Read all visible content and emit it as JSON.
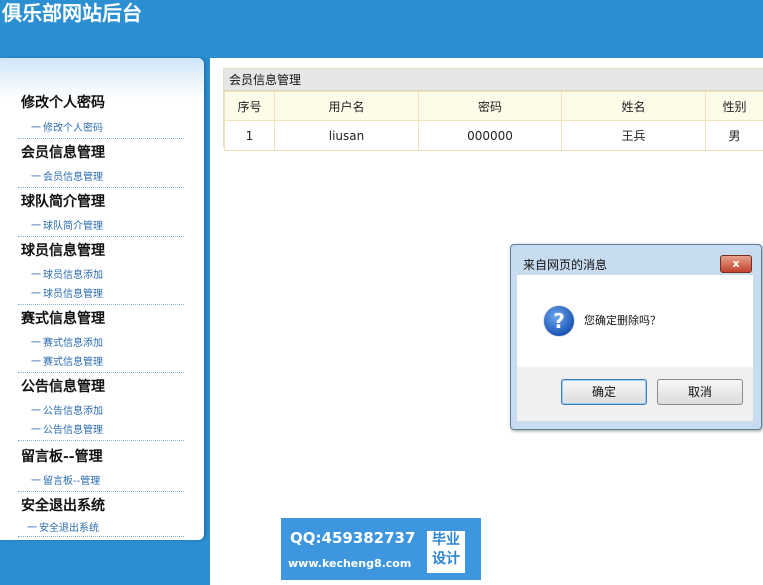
{
  "header": {
    "title": "俱乐部网站后台"
  },
  "sidebar": {
    "groups": [
      {
        "title": "修改个人密码",
        "items": [
          "修改个人密码"
        ]
      },
      {
        "title": "会员信息管理",
        "items": [
          "会员信息管理"
        ]
      },
      {
        "title": "球队简介管理",
        "items": [
          "球队简介管理"
        ]
      },
      {
        "title": "球员信息管理",
        "items": [
          "球员信息添加",
          "球员信息管理"
        ]
      },
      {
        "title": "赛式信息管理",
        "items": [
          "赛式信息添加",
          "赛式信息管理"
        ]
      },
      {
        "title": "公告信息管理",
        "items": [
          "公告信息添加",
          "公告信息管理"
        ]
      },
      {
        "title": "留言板--管理",
        "items": [
          "留言板--管理"
        ]
      },
      {
        "title": "安全退出系统",
        "items": [
          "安全退出系统"
        ]
      }
    ],
    "dash": "一"
  },
  "main": {
    "panel_title": "会员信息管理",
    "columns": [
      "序号",
      "用户名",
      "密码",
      "姓名",
      "性别"
    ],
    "rows": [
      [
        "1",
        "liusan",
        "000000",
        "王兵",
        "男"
      ]
    ]
  },
  "dialog": {
    "title": "来自网页的消息",
    "close_label": "x",
    "icon": "question-icon",
    "icon_glyph": "?",
    "message": "您确定删除吗？",
    "ok_label": "确定",
    "cancel_label": "取消"
  },
  "watermark": {
    "qq": "QQ:459382737",
    "url": "www.kecheng8.com",
    "badge_line1": "毕业",
    "badge_line2": "设计"
  }
}
